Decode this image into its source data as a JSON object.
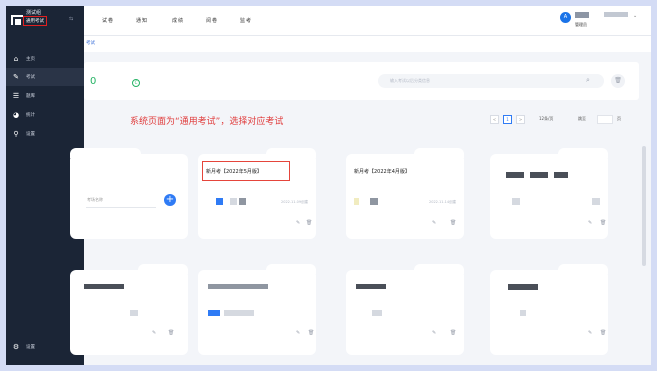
{
  "brand": {
    "name": "测试组",
    "subtitle": "通用考试",
    "collapse_icon": "collapse-icon"
  },
  "sidebar": {
    "items": [
      {
        "label": "主页",
        "icon": "home-icon"
      },
      {
        "label": "考试",
        "icon": "exam-icon"
      },
      {
        "label": "题库",
        "icon": "question-bank-icon"
      },
      {
        "label": "统计",
        "icon": "stats-icon"
      },
      {
        "label": "设置",
        "icon": "settings-icon"
      },
      {
        "label": "设置",
        "icon": "gear-icon"
      }
    ]
  },
  "topbar": {
    "tabs": [
      "试卷",
      "通知",
      "成绩",
      "阅卷",
      "监考"
    ],
    "user_role": "管理员",
    "avatar_text": "A"
  },
  "breadcrumb": "考试",
  "stats": {
    "count": "0"
  },
  "search": {
    "placeholder": "输入考试以后分类信息"
  },
  "annotation": "系统页面为“通用考试”，选择对应考试",
  "pager": {
    "prev": "<",
    "current": "1",
    "next": ">",
    "page_size": "12条/页",
    "jump_label": "跳至",
    "page_suffix": "页"
  },
  "add_card": {
    "input_placeholder": "考场名称"
  },
  "cards": [
    {
      "title": "新月考【2022年5月版】",
      "date": "2022.11.09创建"
    },
    {
      "title": "新月考【2022年4月版】",
      "date": "2022.11.14创建"
    }
  ],
  "colors": {
    "sidebar": "#1b2536",
    "accent": "#2f7bf5",
    "success": "#25b364",
    "annotation": "#e03b3b"
  }
}
